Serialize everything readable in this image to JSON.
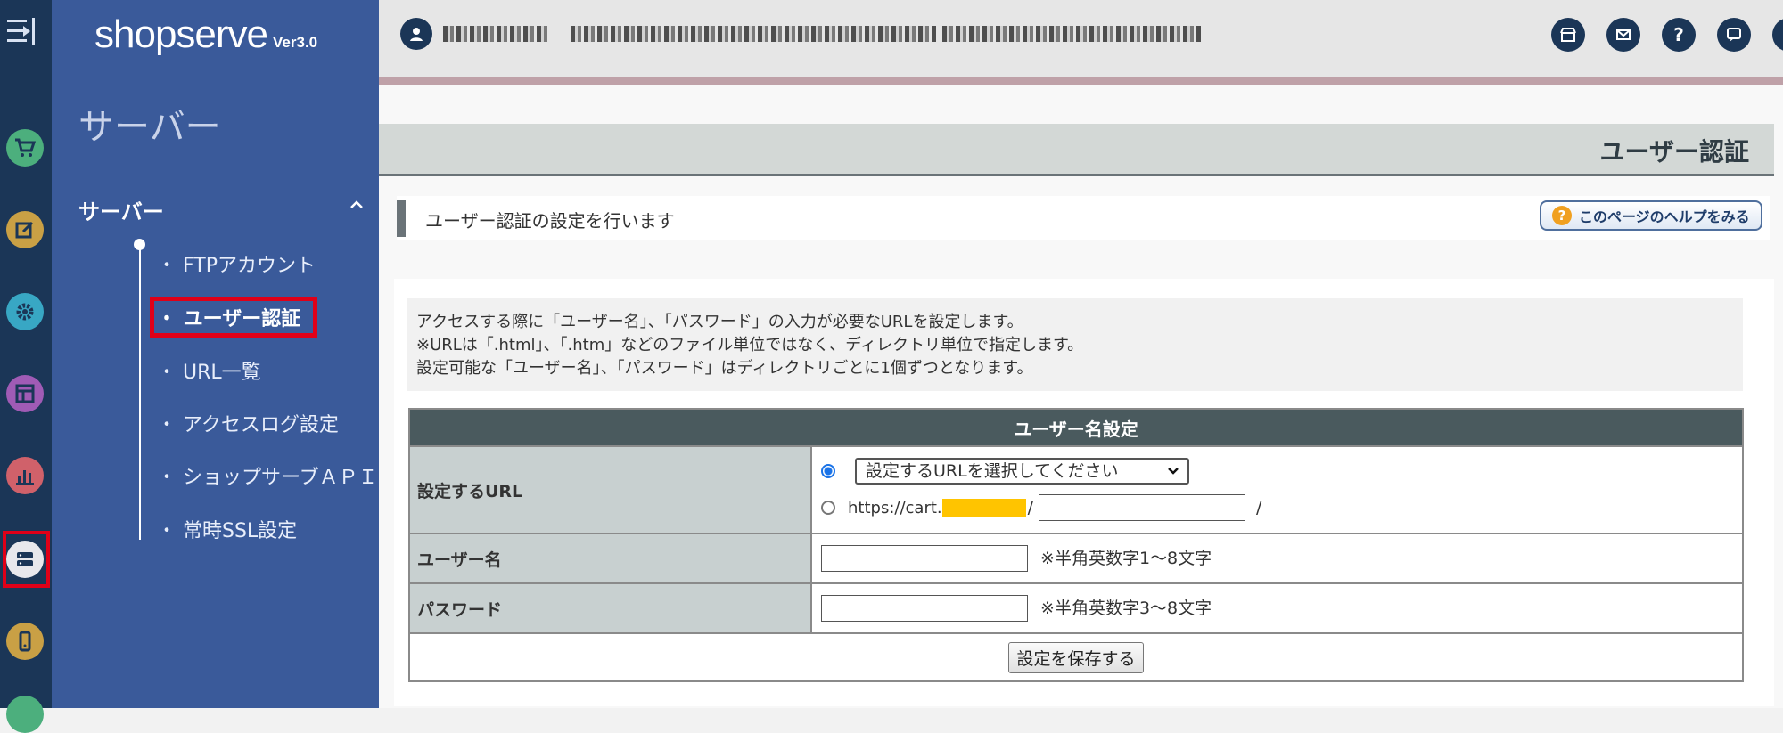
{
  "sidebar": {
    "logo_main": "shopserve",
    "logo_version": "Ver3.0",
    "title": "サーバー",
    "section_label": "サーバー",
    "items": [
      {
        "label": "・ FTPアカウント"
      },
      {
        "label": "・ ユーザー認証"
      },
      {
        "label": "・ URL一覧"
      },
      {
        "label": "・ アクセスログ設定"
      },
      {
        "label": "・ ショップサーブＡＰＩ"
      },
      {
        "label": "・ 常時SSL設定"
      }
    ]
  },
  "rail_icons": [
    "cart-icon",
    "edit-icon",
    "gear-icon",
    "layout-icon",
    "chart-icon",
    "server-icon",
    "mobile-icon"
  ],
  "header": {
    "help_glyph": "?"
  },
  "page": {
    "title": "ユーザー認証",
    "lead": "ユーザー認証の設定を行います",
    "help_button": "このページのヘルプをみる",
    "help_q": "?",
    "notice_lines": [
      "アクセスする際に「ユーザー名」、「パスワード」の入力が必要なURLを設定します。",
      "※URLは「.html」、「.htm」などのファイル単位ではなく、ディレクトリ単位で指定します。",
      "設定可能な「ユーザー名」、「パスワード」はディレクトリごとに1個ずつとなります。"
    ]
  },
  "form": {
    "heading": "ユーザー名設定",
    "url_label": "設定するURL",
    "url_select": "設定するURLを選択してください",
    "url_prefix": "https://cart.",
    "url_slash1": "/",
    "url_slash2": "/",
    "username_label": "ユーザー名",
    "username_hint": "※半角英数字1～8文字",
    "password_label": "パスワード",
    "password_hint": "※半角英数字3～8文字",
    "save_button": "設定を保存する"
  },
  "colors": {
    "rail": "#1b3657",
    "sidebar": "#3a5a9a",
    "highlight": "#e00018",
    "table_head": "#4a5a5e"
  }
}
